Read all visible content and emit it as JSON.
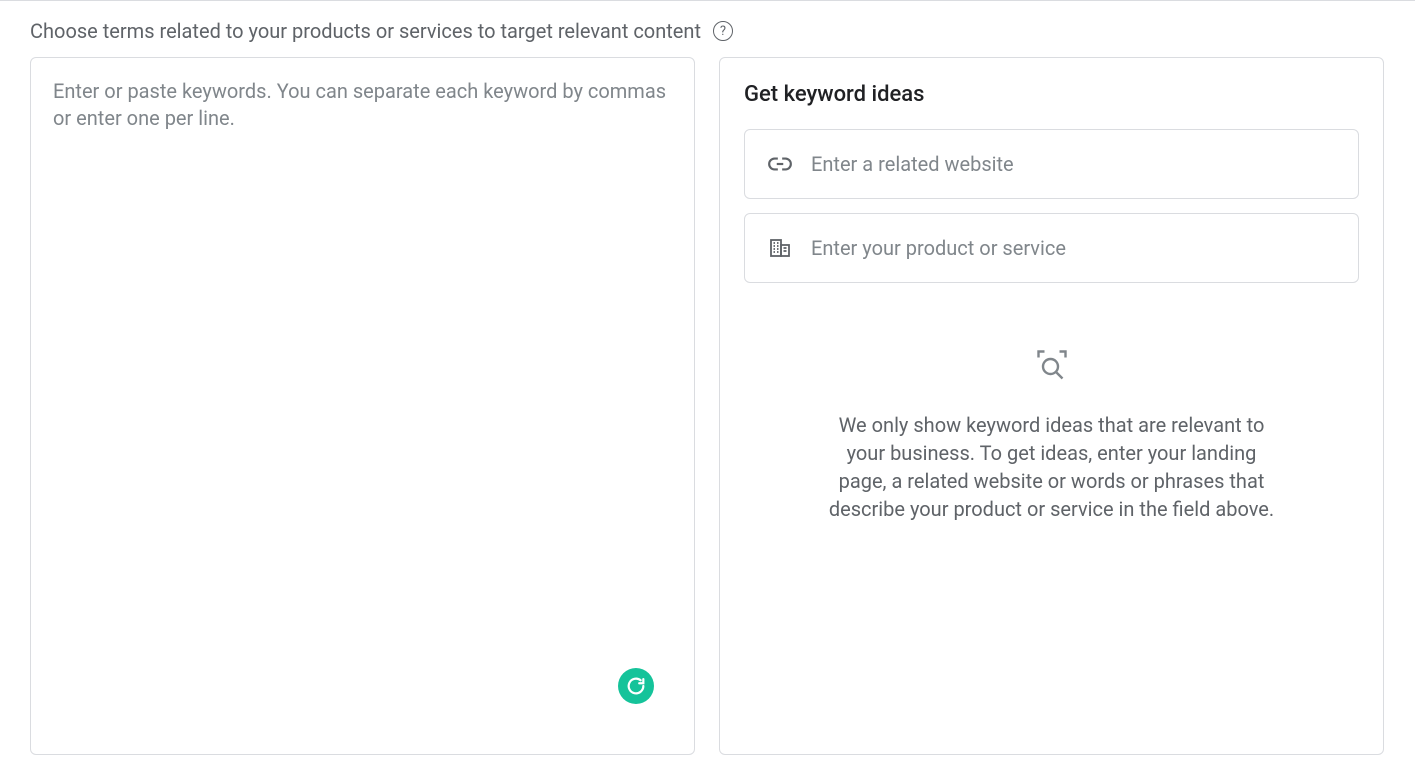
{
  "header": {
    "instruction": "Choose terms related to your products or services to target relevant content"
  },
  "left": {
    "keywords_placeholder": "Enter or paste keywords. You can separate each keyword by commas or enter one per line."
  },
  "right": {
    "title": "Get keyword ideas",
    "website_placeholder": "Enter a related website",
    "product_placeholder": "Enter your product or service",
    "empty_message": "We only show keyword ideas that are relevant to your business. To get ideas, enter your landing page, a related website or words or phrases that describe your product or service in the field above."
  }
}
